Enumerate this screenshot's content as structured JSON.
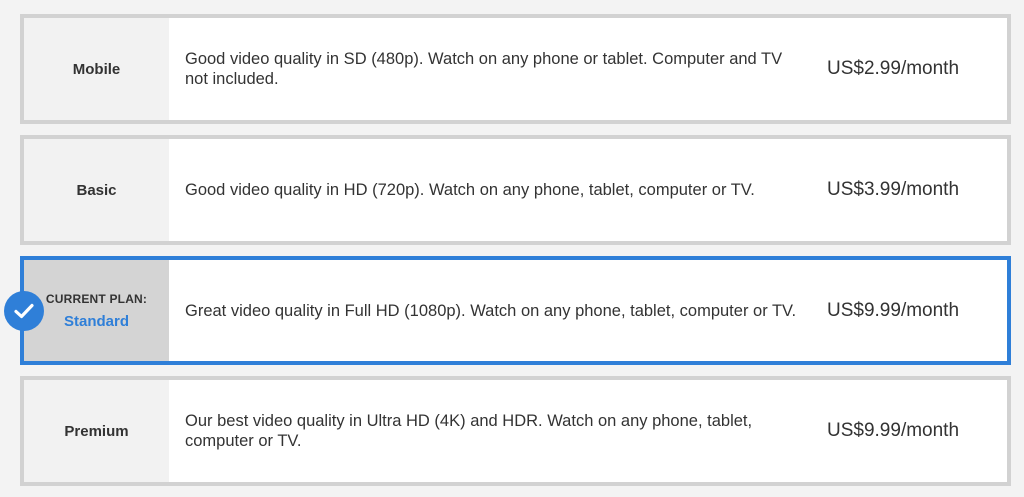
{
  "accent_color": "#2f7fd8",
  "plans": [
    {
      "name": "Mobile",
      "description": "Good video quality in SD (480p). Watch on any phone or tablet. Computer and TV not included.",
      "price": "US$2.99/month"
    },
    {
      "name": "Basic",
      "description": "Good video quality in HD (720p). Watch on any phone, tablet, computer or TV.",
      "price": "US$3.99/month"
    },
    {
      "current_label": "CURRENT PLAN:",
      "name": "Standard",
      "description": "Great video quality in Full HD (1080p). Watch on any phone, tablet, computer or TV.",
      "price": "US$9.99/month",
      "selected_icon": "checkmark-icon"
    },
    {
      "name": "Premium",
      "description": "Our best video quality in Ultra HD (4K) and HDR. Watch on any phone, tablet, computer or TV.",
      "price": "US$9.99/month"
    }
  ]
}
